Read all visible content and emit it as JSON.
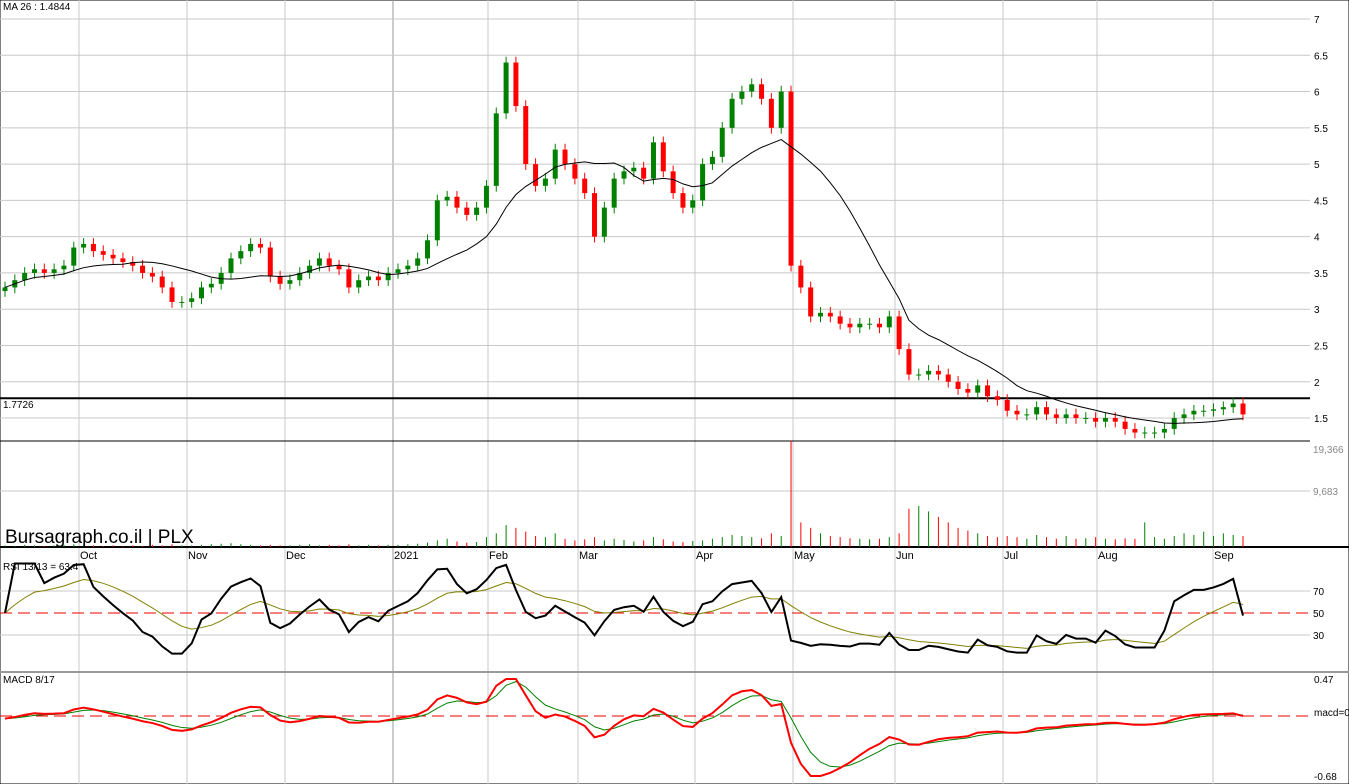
{
  "chart_data": {
    "type": "candlestick",
    "symbol_label": "Bursagraph.co.il | PLX",
    "ma_label": "MA 26 : 1.4844",
    "hline_label": "1.7726",
    "hline_value": 1.7726,
    "price_ticks": [
      "7",
      "6.5",
      "6",
      "5.5",
      "5",
      "4.5",
      "4",
      "3.5",
      "3",
      "2.5",
      "2",
      "1.5"
    ],
    "price_range": [
      1.5,
      7
    ],
    "volume_ticks": [
      "19,366",
      "9,683"
    ],
    "volume_max": 19366,
    "months": [
      "Oct",
      "Nov",
      "Dec",
      "2021",
      "Feb",
      "Mar",
      "Apr",
      "May",
      "Jun",
      "Jul",
      "Aug",
      "Sep"
    ],
    "rsi": {
      "label": "RSI 13/13 = 63.4",
      "ticks": [
        "70",
        "50",
        "30"
      ]
    },
    "macd": {
      "label": "MACD 8/17",
      "ticks": [
        "0.47",
        "macd=0",
        "-0.68"
      ],
      "range": [
        -0.68,
        0.47
      ]
    },
    "close": [
      3.3,
      3.4,
      3.5,
      3.55,
      3.5,
      3.55,
      3.6,
      3.85,
      3.9,
      3.8,
      3.75,
      3.7,
      3.65,
      3.6,
      3.5,
      3.45,
      3.3,
      3.1,
      3.1,
      3.15,
      3.3,
      3.35,
      3.5,
      3.7,
      3.8,
      3.9,
      3.85,
      3.45,
      3.35,
      3.4,
      3.5,
      3.6,
      3.7,
      3.6,
      3.55,
      3.3,
      3.4,
      3.45,
      3.4,
      3.5,
      3.55,
      3.6,
      3.7,
      3.95,
      4.5,
      4.55,
      4.4,
      4.3,
      4.4,
      4.7,
      5.7,
      6.4,
      5.8,
      5.0,
      4.7,
      4.8,
      5.2,
      5.0,
      4.8,
      4.6,
      4.0,
      4.4,
      4.8,
      4.9,
      4.95,
      4.8,
      5.3,
      4.9,
      4.6,
      4.4,
      4.5,
      5.0,
      5.1,
      5.5,
      5.9,
      6.0,
      6.1,
      5.9,
      5.5,
      6.0,
      3.6,
      3.3,
      2.9,
      2.95,
      2.9,
      2.8,
      2.75,
      2.8,
      2.8,
      2.75,
      2.9,
      2.45,
      2.1,
      2.1,
      2.15,
      2.1,
      2.0,
      1.9,
      1.85,
      1.95,
      1.8,
      1.75,
      1.6,
      1.55,
      1.55,
      1.65,
      1.55,
      1.5,
      1.55,
      1.5,
      1.5,
      1.45,
      1.5,
      1.45,
      1.35,
      1.3,
      1.3,
      1.3,
      1.35,
      1.5,
      1.55,
      1.6,
      1.6,
      1.62,
      1.65,
      1.7,
      1.55
    ],
    "volume": [
      300,
      200,
      400,
      300,
      200,
      300,
      400,
      500,
      400,
      300,
      200,
      300,
      200,
      300,
      200,
      400,
      300,
      500,
      300,
      300,
      400,
      500,
      600,
      700,
      500,
      400,
      300,
      400,
      300,
      300,
      400,
      500,
      300,
      400,
      300,
      500,
      300,
      400,
      300,
      400,
      400,
      500,
      600,
      800,
      1200,
      1500,
      1000,
      800,
      900,
      1800,
      2500,
      4000,
      3500,
      2800,
      2000,
      1800,
      2500,
      1500,
      1200,
      1400,
      1800,
      1200,
      1500,
      1300,
      1000,
      1200,
      1800,
      1400,
      1000,
      900,
      1100,
      1200,
      1500,
      1800,
      2200,
      2000,
      1800,
      1600,
      2500,
      2000,
      19366,
      4500,
      3500,
      2500,
      2000,
      1800,
      1600,
      1500,
      1400,
      1500,
      1800,
      2500,
      7000,
      7500,
      6500,
      5500,
      4500,
      3500,
      3000,
      2500,
      2000,
      1800,
      2000,
      1800,
      1500,
      2200,
      1800,
      1500,
      2000,
      1500,
      1600,
      1800,
      1500,
      1400,
      1600,
      1500,
      4500,
      1800,
      1500,
      2000,
      2500,
      2200,
      2800,
      2000,
      2500,
      2200,
      2000
    ]
  }
}
